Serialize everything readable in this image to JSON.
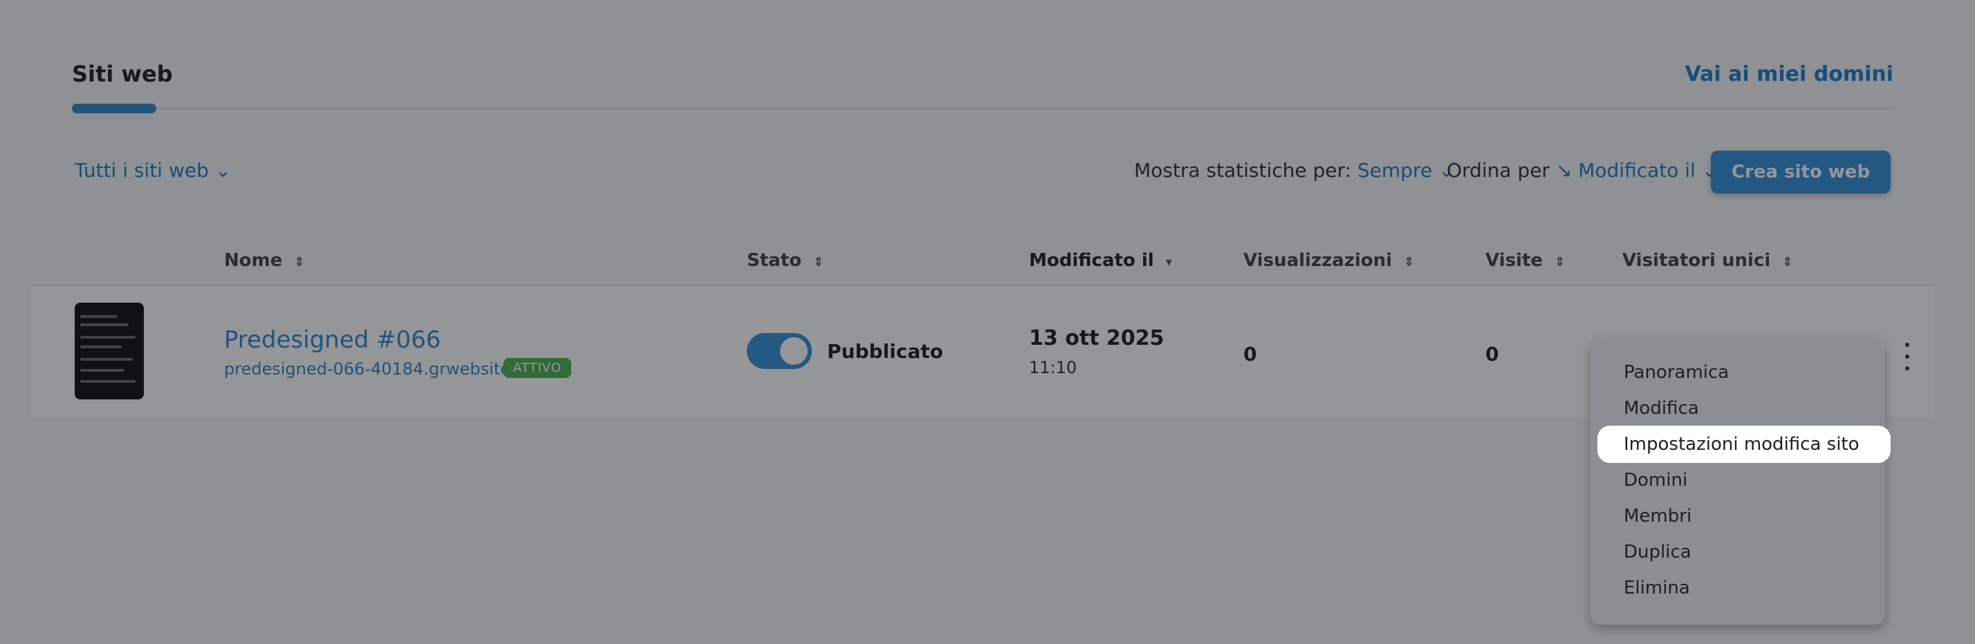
{
  "header": {
    "tab_active": "Siti web",
    "domains_link": "Vai ai miei domini"
  },
  "toolbar": {
    "filter_label": "Tutti i siti web",
    "stats_label": "Mostra statistiche per:",
    "stats_value": "Sempre",
    "sort_label": "Ordina per",
    "sort_value": "Modificato il",
    "create_button": "Crea sito web"
  },
  "table": {
    "headers": [
      "Nome",
      "Stato",
      "Modificato il",
      "Visualizzazioni",
      "Visite",
      "Visitatori unici"
    ],
    "rows": [
      {
        "name": "Predesigned #066",
        "url": "predesigned-066-40184.grwebsite.es",
        "badge": "ATTIVO",
        "status": "Pubblicato",
        "published": true,
        "modified_date": "13 ott 2025",
        "modified_time": "11:10",
        "views": "0",
        "visits": "0"
      }
    ]
  },
  "menu": {
    "items": [
      "Panoramica",
      "Modifica",
      "Impostazioni modifica sito",
      "Domini",
      "Membri",
      "Duplica",
      "Elimina"
    ],
    "highlighted": "Impostazioni modifica sito"
  },
  "colors": {
    "accent": "#2f8fd8",
    "link": "#1a7bc5",
    "badge": "#4caf50"
  },
  "icons": {
    "sort": "sort-icon",
    "chevron": "chevron-down-icon",
    "kebab": "kebab-menu-icon"
  }
}
